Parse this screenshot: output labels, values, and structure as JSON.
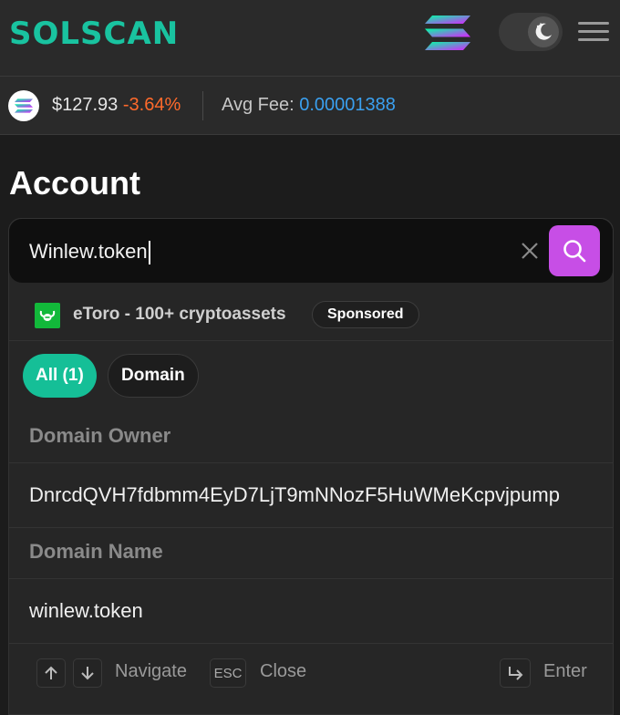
{
  "header": {
    "logo_text": "SOLSCAN",
    "colors": {
      "brand": "#19c3a0",
      "accent": "#c74ee6"
    }
  },
  "ticker": {
    "price": "$127.93",
    "change": "-3.64%",
    "fee_label": "Avg Fee:",
    "fee_value": "0.00001388"
  },
  "page": {
    "title": "Account"
  },
  "search": {
    "value": "Winlew.token"
  },
  "sponsor": {
    "text": "eToro - 100+ cryptoassets",
    "badge": "Sponsored"
  },
  "filters": {
    "all_label": "All (1)",
    "domain_label": "Domain"
  },
  "results": {
    "owner_heading": "Domain Owner",
    "owner_value": "DnrcdQVH7fdbmm4EyD7LjT9mNNozF5HuWMeKcpvjpump",
    "name_heading": "Domain Name",
    "name_value": "winlew.token"
  },
  "footer": {
    "navigate_label": "Navigate",
    "esc_key": "ESC",
    "close_label": "Close",
    "enter_label": "Enter"
  }
}
